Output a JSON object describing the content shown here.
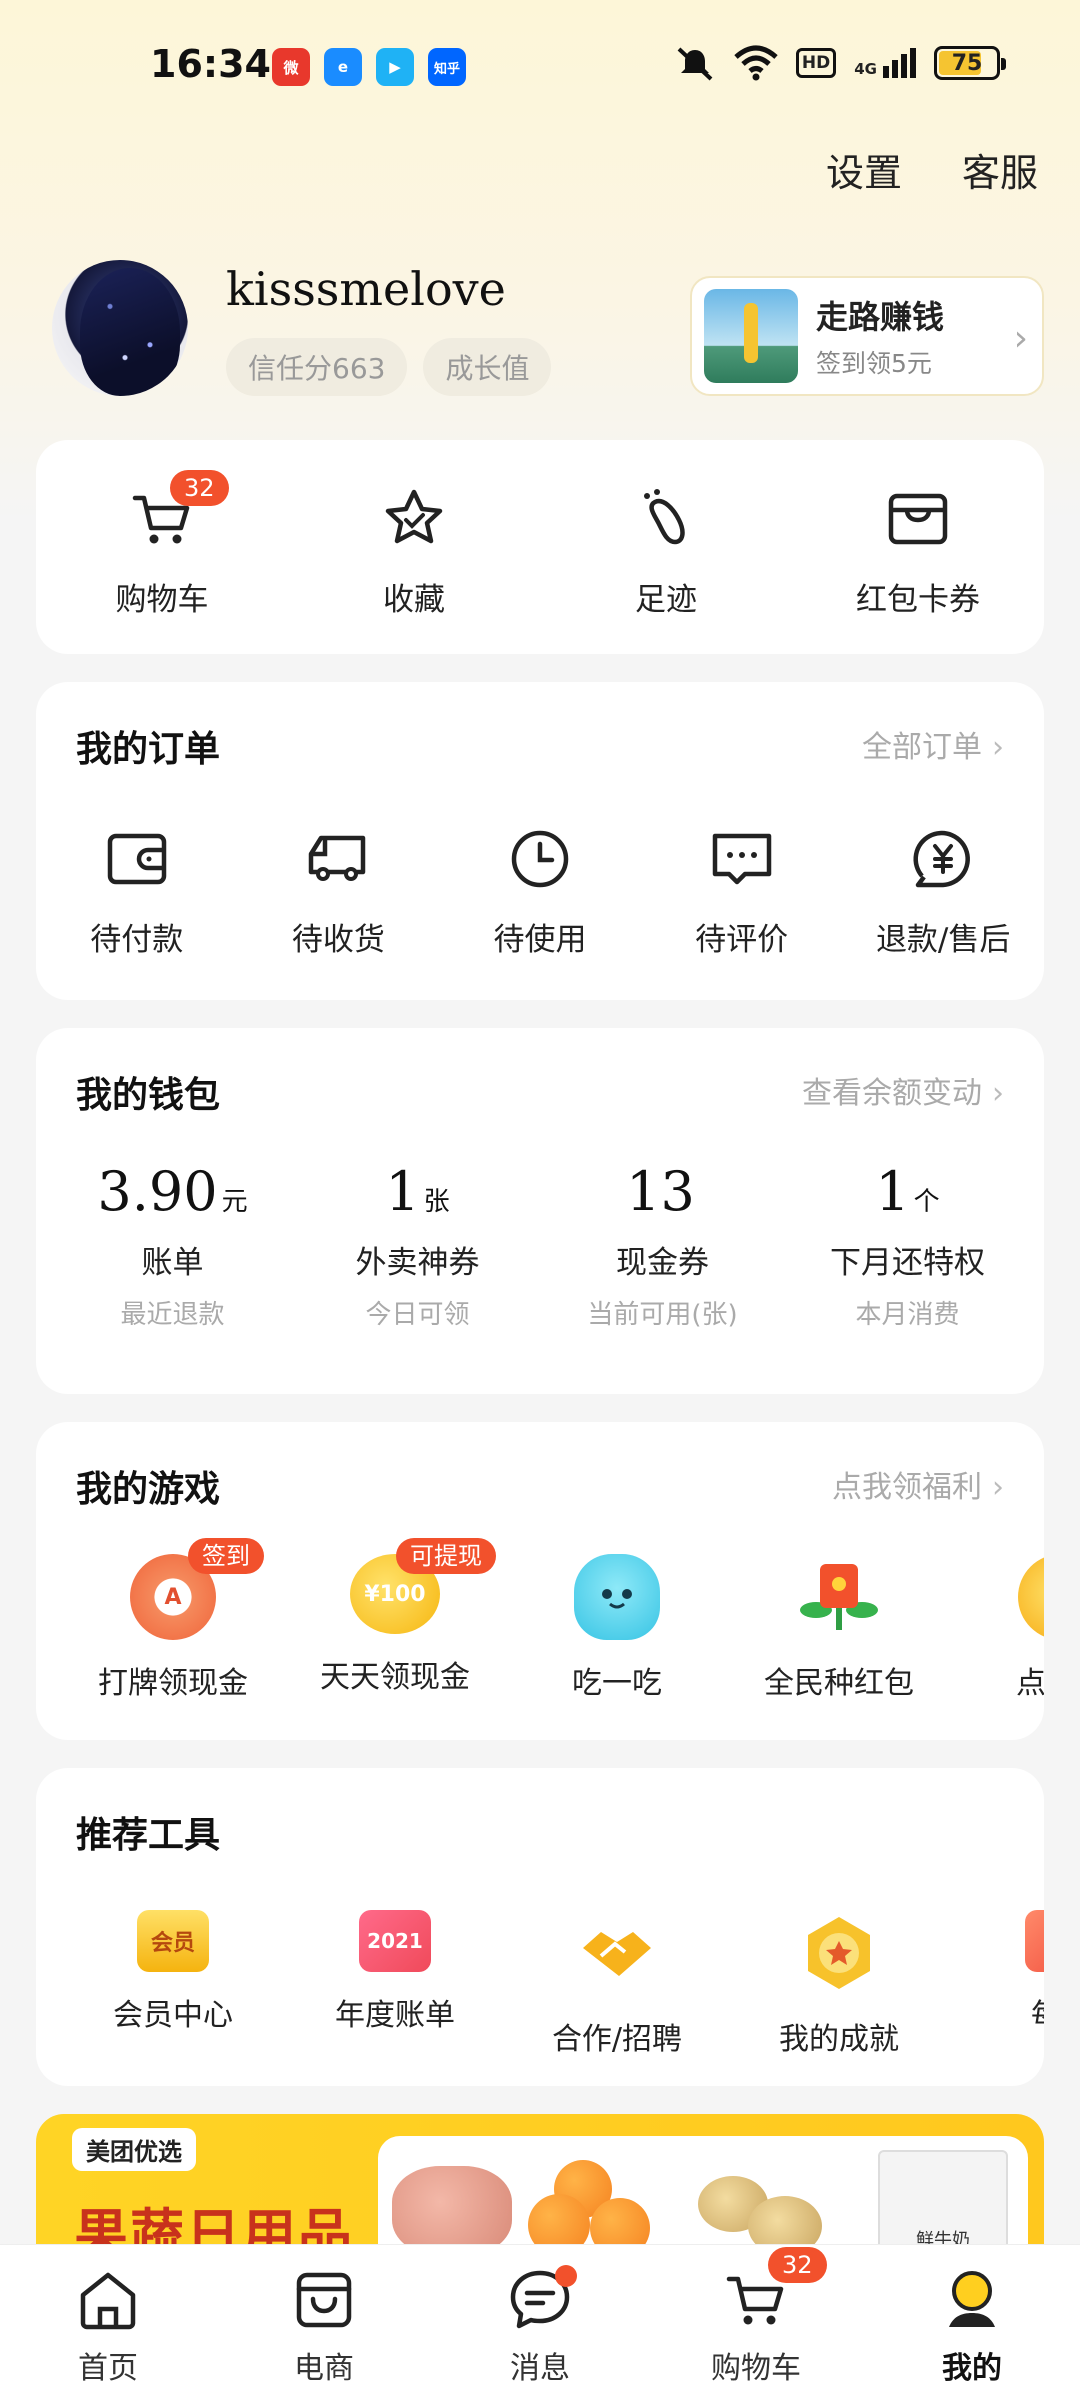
{
  "status": {
    "time": "16:34",
    "apps": [
      {
        "icon": "weibo-icon",
        "text": "微",
        "color": "#e8382c"
      },
      {
        "icon": "eleme-icon",
        "text": "e",
        "color": "#1a8cff"
      },
      {
        "icon": "youku-icon",
        "text": "▶",
        "color": "#1fb2f5"
      },
      {
        "icon": "zhihu-icon",
        "text": "知乎",
        "color": "#0066ff"
      }
    ],
    "network": "4G",
    "hd": "HD",
    "battery": "75",
    "battery_level": 0.75
  },
  "top_links": {
    "settings": "设置",
    "service": "客服"
  },
  "profile": {
    "username": "kisssmelove",
    "credit": "信任分663",
    "growth": "成长值"
  },
  "walk_card": {
    "title": "走路赚钱",
    "subtitle": "签到领5元"
  },
  "quick": {
    "items": [
      {
        "label": "购物车",
        "icon": "cart-icon",
        "badge": "32"
      },
      {
        "label": "收藏",
        "icon": "star-icon"
      },
      {
        "label": "足迹",
        "icon": "footprint-icon"
      },
      {
        "label": "红包卡券",
        "icon": "wallet-card-icon"
      }
    ]
  },
  "orders": {
    "title": "我的订单",
    "link": "全部订单",
    "items": [
      {
        "label": "待付款",
        "icon": "wallet-icon"
      },
      {
        "label": "待收货",
        "icon": "truck-icon"
      },
      {
        "label": "待使用",
        "icon": "clock-icon"
      },
      {
        "label": "待评价",
        "icon": "comment-icon"
      },
      {
        "label": "退款/售后",
        "icon": "yuan-refund-icon"
      }
    ]
  },
  "wallet": {
    "title": "我的钱包",
    "link": "查看余额变动",
    "items": [
      {
        "value": "3.90",
        "unit": "元",
        "label": "账单",
        "sub": "最近退款"
      },
      {
        "value": "1",
        "unit": "张",
        "label": "外卖神券",
        "sub": "今日可领"
      },
      {
        "value": "13",
        "unit": "",
        "label": "现金券",
        "sub": "当前可用(张)"
      },
      {
        "value": "1",
        "unit": "个",
        "label": "下月还特权",
        "sub": "本月消费"
      }
    ]
  },
  "games": {
    "title": "我的游戏",
    "link": "点我领福利",
    "items": [
      {
        "label": "打牌领现金",
        "icon": "poker-icon",
        "badge": "签到"
      },
      {
        "label": "天天领现金",
        "icon": "coin-100-icon",
        "badge": "可提现",
        "icon_text": "¥100"
      },
      {
        "label": "吃一吃",
        "icon": "blue-ghost-icon"
      },
      {
        "label": "全民种红包",
        "icon": "red-envelope-plant-icon"
      },
      {
        "label": "点点就",
        "icon": "gold-coin-icon"
      }
    ]
  },
  "tools": {
    "title": "推荐工具",
    "items": [
      {
        "label": "会员中心",
        "icon": "member-icon",
        "icon_text": "会员"
      },
      {
        "label": "年度账单",
        "icon": "calendar-2021-icon",
        "icon_text": "2021"
      },
      {
        "label": "合作/招聘",
        "icon": "handshake-icon"
      },
      {
        "label": "我的成就",
        "icon": "achievement-icon"
      },
      {
        "label": "每日",
        "icon": "daily-icon",
        "icon_text": "¥"
      }
    ]
  },
  "banner": {
    "tag": "美团优选",
    "title": "果蔬日用品",
    "milk": "鲜牛奶"
  },
  "nav": {
    "items": [
      {
        "label": "首页",
        "icon": "home-icon"
      },
      {
        "label": "电商",
        "icon": "shopping-bag-icon"
      },
      {
        "label": "消息",
        "icon": "message-icon"
      },
      {
        "label": "购物车",
        "icon": "cart-icon",
        "badge": "32"
      },
      {
        "label": "我的",
        "icon": "profile-icon"
      }
    ]
  }
}
